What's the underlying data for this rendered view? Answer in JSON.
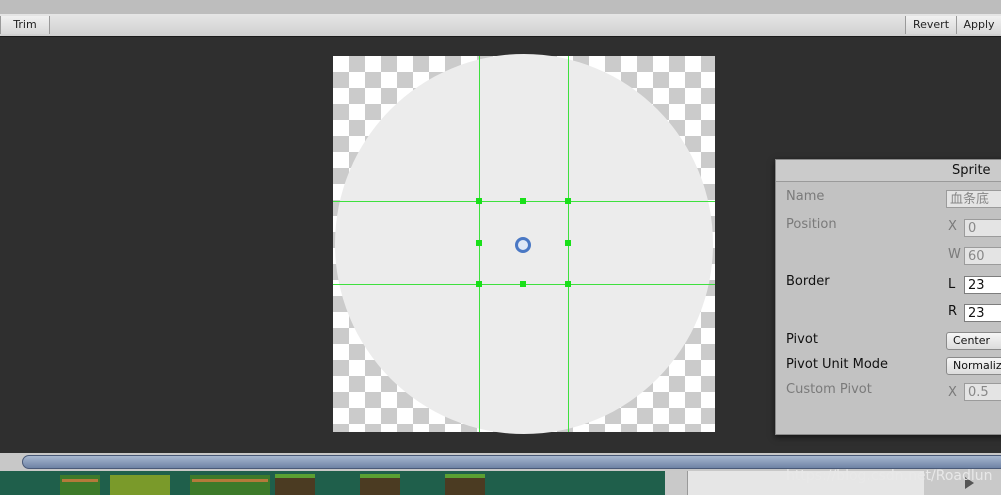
{
  "toolbar": {
    "trim_label": "Trim",
    "revert_label": "Revert",
    "apply_label": "Apply"
  },
  "sprite_panel": {
    "title": "Sprite",
    "name_label": "Name",
    "name_value": "血条底",
    "position_label": "Position",
    "position_x_axis": "X",
    "position_x_value": "0",
    "position_w_axis": "W",
    "position_w_value": "60",
    "border_label": "Border",
    "border_l_axis": "L",
    "border_l_value": "23",
    "border_r_axis": "R",
    "border_r_value": "23",
    "pivot_label": "Pivot",
    "pivot_value": "Center",
    "pivot_unit_mode_label": "Pivot Unit Mode",
    "pivot_unit_mode_value": "Normalized",
    "custom_pivot_label": "Custom Pivot",
    "custom_pivot_x_axis": "X",
    "custom_pivot_x_value": "0.5"
  },
  "watermark": "https://blog.csdn.net/Roadlun",
  "colors": {
    "slice_line": "#3ee03e",
    "pivot": "#4a78c4",
    "sprite_fill": "#ececec"
  },
  "icons": {
    "pivot": "pivot-handle-icon",
    "play": "play-icon"
  }
}
